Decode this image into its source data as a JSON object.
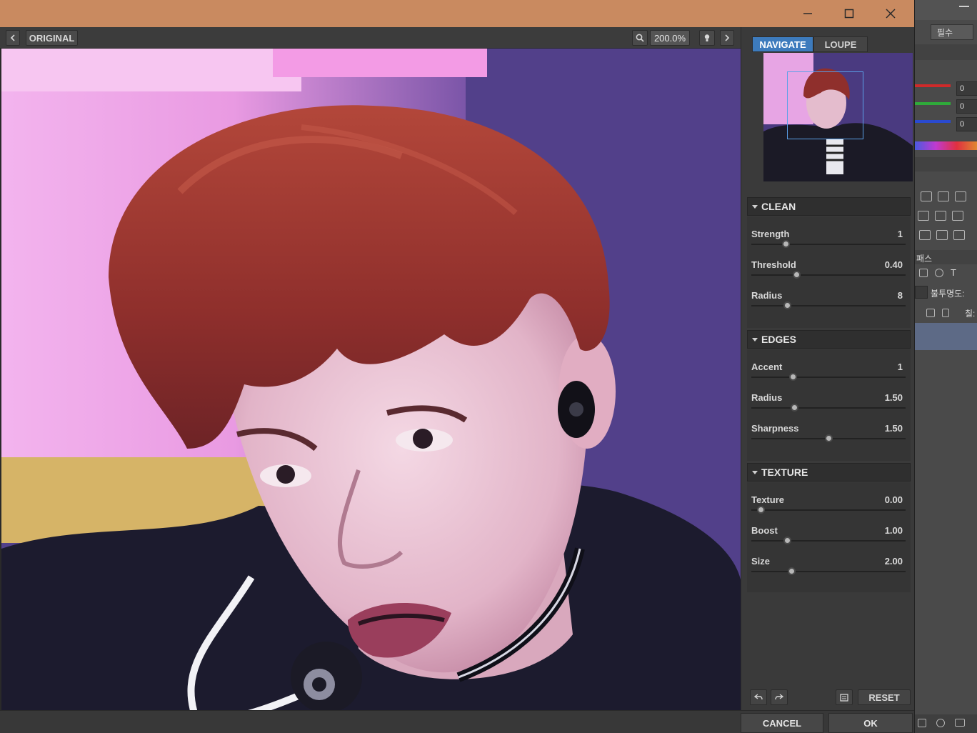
{
  "window": {
    "title_bar_color": "#c98a60",
    "controls": [
      "minimize-icon",
      "maximize-icon",
      "close-icon"
    ]
  },
  "toolbar": {
    "original_label": "ORIGINAL",
    "zoom_value": "200.0%"
  },
  "navigator": {
    "tabs": [
      {
        "label": "NAVIGATE",
        "active": true
      },
      {
        "label": "LOUPE",
        "active": false
      }
    ]
  },
  "sections": {
    "clean": {
      "title": "CLEAN",
      "rows": [
        {
          "label": "Strength",
          "value": "1",
          "fraction": 0.22
        },
        {
          "label": "Threshold",
          "value": "0.40",
          "fraction": 0.29
        },
        {
          "label": "Radius",
          "value": "8",
          "fraction": 0.23
        }
      ]
    },
    "edges": {
      "title": "EDGES",
      "rows": [
        {
          "label": "Accent",
          "value": "1",
          "fraction": 0.27
        },
        {
          "label": "Radius",
          "value": "1.50",
          "fraction": 0.28
        },
        {
          "label": "Sharpness",
          "value": "1.50",
          "fraction": 0.5
        }
      ]
    },
    "texture": {
      "title": "TEXTURE",
      "rows": [
        {
          "label": "Texture",
          "value": "0.00",
          "fraction": 0.06
        },
        {
          "label": "Boost",
          "value": "1.00",
          "fraction": 0.23
        },
        {
          "label": "Size",
          "value": "2.00",
          "fraction": 0.26
        }
      ]
    }
  },
  "footer": {
    "reset_label": "RESET",
    "cancel_label": "CANCEL",
    "ok_label": "OK"
  },
  "host_panel": {
    "top_label": "필수",
    "rgb_values": [
      "0",
      "0",
      "0"
    ],
    "layers_tab": "패스",
    "opacity_label": "불투명도:",
    "fill_label": "칠:"
  },
  "colors": {
    "accent": "#3d7bbd",
    "panel_bg": "#3a3a3a",
    "slider_red": "#d02a2a",
    "slider_green": "#2faa3a",
    "slider_blue": "#2a4ad0"
  }
}
